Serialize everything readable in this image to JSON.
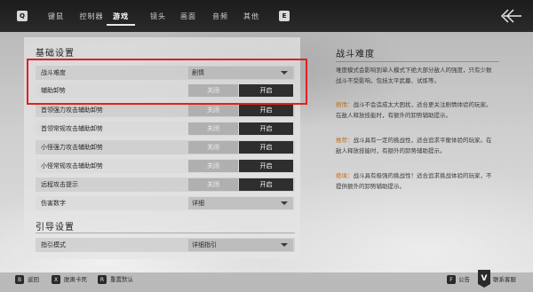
{
  "topbar": {
    "left_key": "Q",
    "right_key": "E",
    "tabs": [
      {
        "label": "键鼠",
        "active": false
      },
      {
        "label": "控制器",
        "active": false
      },
      {
        "label": "游戏",
        "active": true
      },
      {
        "label": "镜头",
        "active": false
      },
      {
        "label": "画面",
        "active": false
      },
      {
        "label": "音频",
        "active": false
      },
      {
        "label": "其他",
        "active": false
      }
    ]
  },
  "basic": {
    "title": "基础设置",
    "rows": [
      {
        "label": "战斗难度",
        "type": "select",
        "value": "剧情"
      },
      {
        "label": "辅助卸势",
        "type": "toggle",
        "off": "关闭",
        "on": "开启"
      },
      {
        "label": "首领强力攻击辅助卸势",
        "type": "toggle",
        "off": "关闭",
        "on": "开启"
      },
      {
        "label": "首领常规攻击辅助卸势",
        "type": "toggle",
        "off": "关闭",
        "on": "开启"
      },
      {
        "label": "小怪强力攻击辅助卸势",
        "type": "toggle",
        "off": "关闭",
        "on": "开启"
      },
      {
        "label": "小怪常规攻击辅助卸势",
        "type": "toggle",
        "off": "关闭",
        "on": "开启"
      },
      {
        "label": "远程攻击提示",
        "type": "toggle",
        "off": "关闭",
        "on": "开启"
      },
      {
        "label": "伤害数字",
        "type": "select",
        "value": "详细"
      }
    ]
  },
  "guide": {
    "title": "引导设置",
    "rows": [
      {
        "label": "指引模式",
        "type": "select",
        "value": "详细指引"
      }
    ]
  },
  "detail": {
    "title": "战斗难度",
    "intro": "难度模式会影响到单人模式下绝大部分敌人的强度，只有少数战斗不受影响，包括太平武墓、试炼等。",
    "entries": [
      {
        "key": "剧情：",
        "text": "战斗不会造成太大困扰，适合更关注剧情体验的玩家。在敌人释放技能时，有额外的卸势辅助提示。"
      },
      {
        "key": "推荐：",
        "text": "战斗具有一定的挑战性，适合追求平衡体验的玩家。在敌人释放技能时，有额外的卸势辅助提示。"
      },
      {
        "key": "绝境：",
        "text": "战斗具有极强的挑战性！适合追求挑战体验的玩家，不提供额外的卸势辅助提示。"
      }
    ]
  },
  "bottombar": {
    "items": [
      {
        "key": "B",
        "label": "返回"
      },
      {
        "key": "X",
        "label": "脱离卡死"
      },
      {
        "key": "R",
        "label": "重置默认"
      }
    ],
    "right_items": [
      {
        "key": "F",
        "label": "公告"
      },
      {
        "key": "V",
        "label": "联系客服"
      }
    ]
  },
  "colors": {
    "highlight": "#e02020",
    "accent_key": "#b8742a"
  }
}
